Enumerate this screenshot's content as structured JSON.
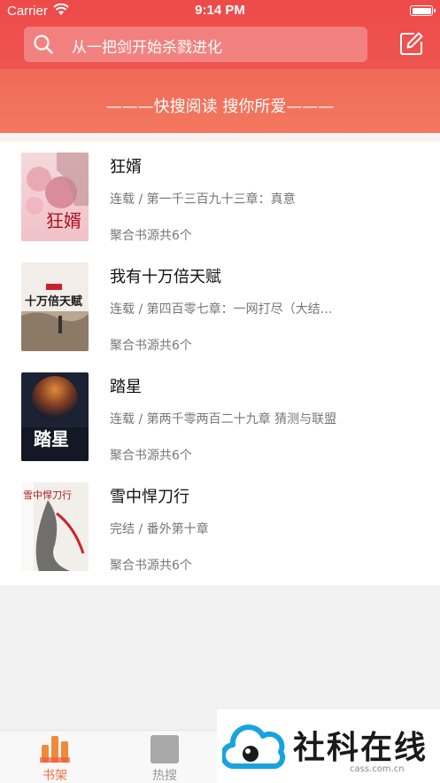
{
  "status_bar": {
    "carrier": "Carrier",
    "time": "9:14 PM"
  },
  "search": {
    "placeholder": "从一把剑开始杀戮进化"
  },
  "slogan": "———快搜阅读 搜你所爱———",
  "books": [
    {
      "title": "狂婿",
      "chapter": "连载 / 第一千三百九十三章：真意",
      "sources": "聚合书源共6个",
      "cover_text": "狂婿"
    },
    {
      "title": "我有十万倍天赋",
      "chapter": "连载 / 第四百零七章：一网打尽（大结…",
      "sources": "聚合书源共6个",
      "cover_text": "十万倍天赋"
    },
    {
      "title": "踏星",
      "chapter": "连载 / 第两千零两百二十九章 猜测与联盟",
      "sources": "聚合书源共6个",
      "cover_text": "踏星"
    },
    {
      "title": "雪中悍刀行",
      "chapter": "完结 / 番外第十章",
      "sources": "聚合书源共6个",
      "cover_text": "雪中悍刀行"
    }
  ],
  "tabs": [
    {
      "label": "书架",
      "active": true
    },
    {
      "label": "热搜",
      "active": false
    }
  ],
  "watermark": {
    "text": "社科在线",
    "url": "cass.com.cn"
  },
  "colors": {
    "accent": "#ee4a4a",
    "tab_active": "#f0703a",
    "tab_inactive": "#999999"
  }
}
